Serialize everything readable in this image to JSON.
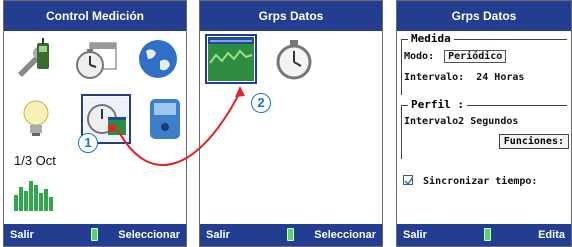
{
  "screen1": {
    "title": "Control Medición",
    "footer_left": "Salir",
    "footer_right": "Seleccionar",
    "date_text": "1/3 Oct",
    "icons": [
      "tool-phone-icon",
      "calendar-timer-icon",
      "globe-icon",
      "lightbulb-icon",
      "timer-chart-icon",
      "meter-device-icon",
      "bar-chart-icon"
    ]
  },
  "screen2": {
    "title": "Grps Datos",
    "footer_left": "Salir",
    "footer_right": "Seleccionar",
    "icons": [
      "chart-icon",
      "stopwatch-icon"
    ]
  },
  "screen3": {
    "title": "Grps Datos",
    "footer_left": "Salir",
    "footer_right": "Edita",
    "medida": {
      "header": "Medida",
      "modo_label": "Modo:",
      "modo_value": "Periódico",
      "intervalo_label": "Intervalo:",
      "intervalo_value": "24 Horas"
    },
    "perfil": {
      "header": "Perfil :",
      "line": "Intervalo2 Segundos",
      "button": "Funciones:"
    },
    "sync_label": "Sincronizar tiempo:"
  },
  "markers": {
    "one": "1",
    "two": "2"
  },
  "colors": {
    "header": "#233d91",
    "arrow": "#e0252a",
    "marker": "#1a73c9",
    "battery": "#5fd16b"
  }
}
